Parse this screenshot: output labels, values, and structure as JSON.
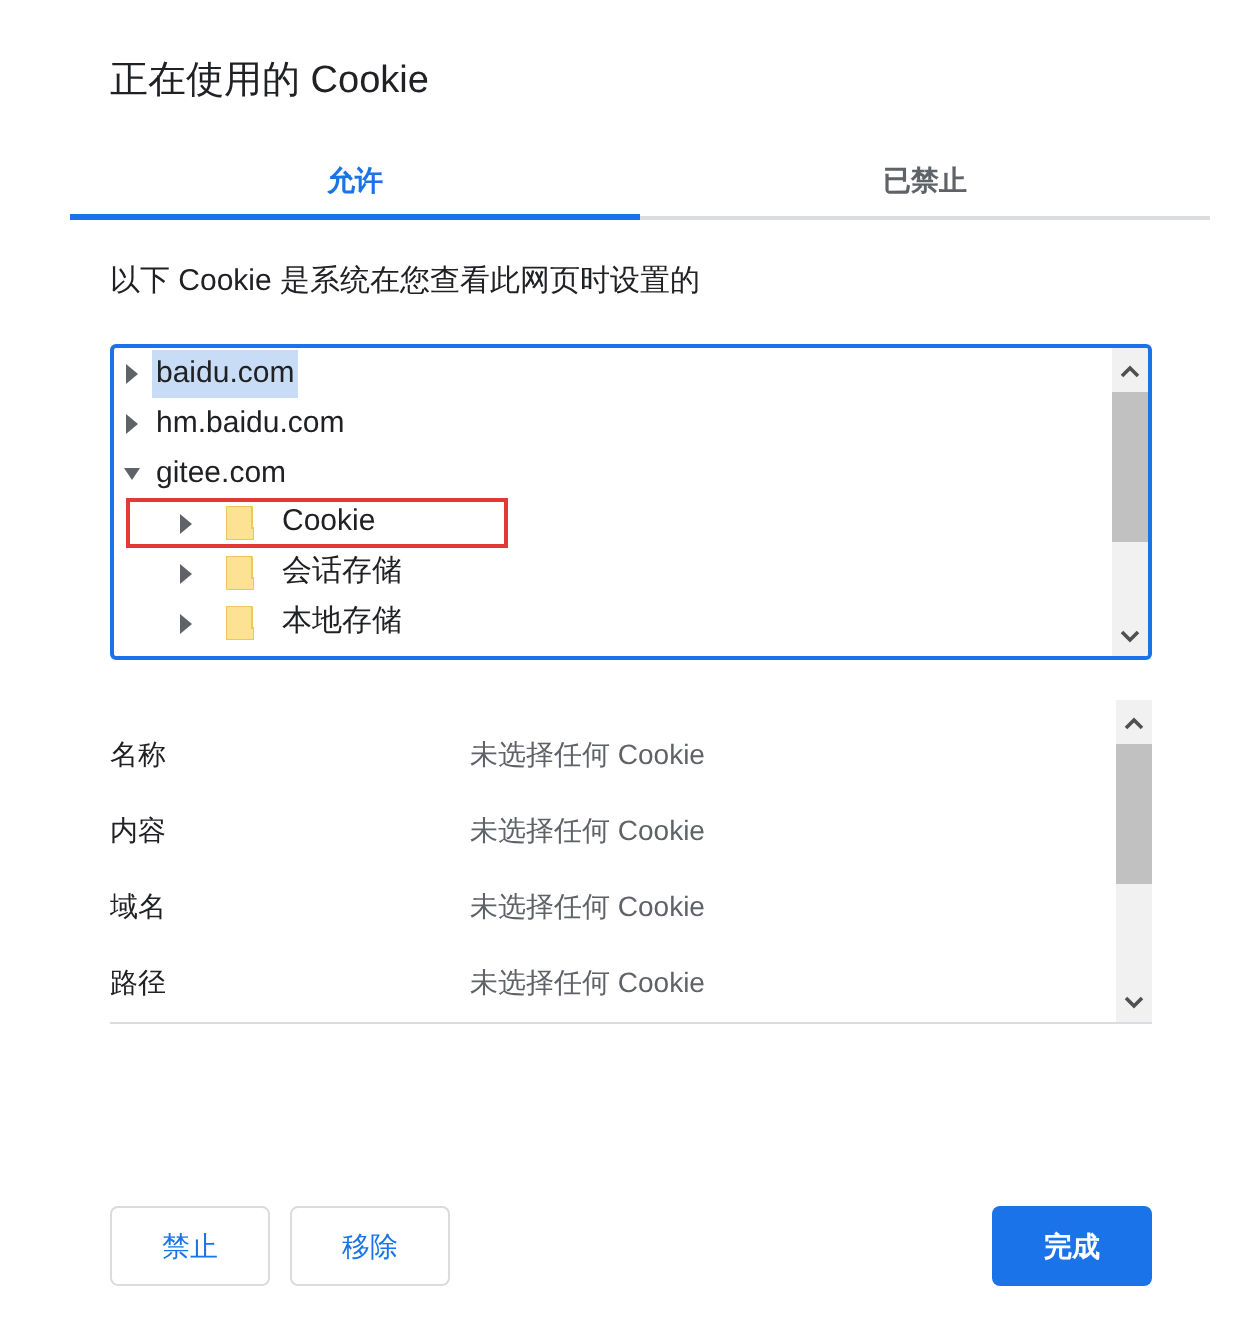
{
  "dialog": {
    "title": "正在使用的 Cookie"
  },
  "tabs": [
    {
      "label": "允许",
      "selected": true
    },
    {
      "label": "已禁止",
      "selected": false
    }
  ],
  "description": "以下 Cookie 是系统在您查看此网页时设置的",
  "tree": [
    {
      "label": "baidu.com",
      "kind": "site",
      "expanded": false,
      "selected": true
    },
    {
      "label": "hm.baidu.com",
      "kind": "site",
      "expanded": false,
      "selected": false
    },
    {
      "label": "gitee.com",
      "kind": "site",
      "expanded": true,
      "selected": false,
      "children": [
        {
          "label": "Cookie",
          "kind": "folder",
          "expanded": false,
          "selected": false,
          "highlighted": true
        },
        {
          "label": "会话存储",
          "kind": "folder",
          "expanded": false,
          "selected": false,
          "highlighted": false
        },
        {
          "label": "本地存储",
          "kind": "folder",
          "expanded": false,
          "selected": false,
          "highlighted": false
        }
      ]
    }
  ],
  "details": [
    {
      "label": "名称",
      "value": "未选择任何 Cookie"
    },
    {
      "label": "内容",
      "value": "未选择任何 Cookie"
    },
    {
      "label": "域名",
      "value": "未选择任何 Cookie"
    },
    {
      "label": "路径",
      "value": "未选择任何 Cookie"
    }
  ],
  "buttons": [
    {
      "label": "禁止",
      "kind": "secondary"
    },
    {
      "label": "移除",
      "kind": "secondary"
    },
    {
      "label": "完成",
      "kind": "primary"
    }
  ]
}
